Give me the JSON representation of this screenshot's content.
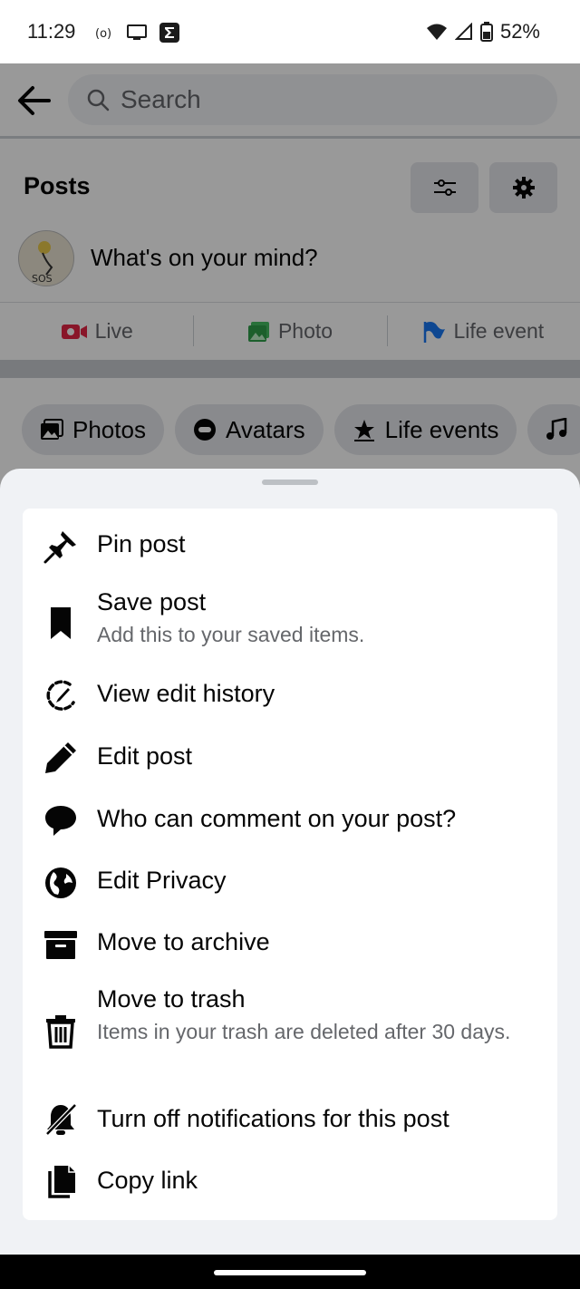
{
  "status_bar": {
    "time": "11:29",
    "battery": "52%",
    "left_icons": [
      "radio-icon",
      "monitor-icon",
      "sigma-icon"
    ],
    "right_icons": [
      "wifi-icon",
      "signal-icon",
      "battery-icon"
    ]
  },
  "header": {
    "search_placeholder": "Search"
  },
  "posts": {
    "title": "Posts",
    "composer_prompt": "What's on your mind?",
    "actions": [
      {
        "label": "Live",
        "color": "#e42645"
      },
      {
        "label": "Photo",
        "color": "#45bd62"
      },
      {
        "label": "Life event",
        "color": "#1877f2"
      }
    ],
    "chips": [
      {
        "label": "Photos"
      },
      {
        "label": "Avatars"
      },
      {
        "label": "Life events"
      },
      {
        "label": ""
      }
    ]
  },
  "sheet": {
    "items": [
      {
        "title": "Pin post",
        "icon": "pin-icon"
      },
      {
        "title": "Save post",
        "subtitle": "Add this to your saved items.",
        "icon": "bookmark-icon"
      },
      {
        "title": "View edit history",
        "icon": "edit-history-icon"
      },
      {
        "title": "Edit post",
        "icon": "pencil-icon"
      },
      {
        "title": "Who can comment on your post?",
        "icon": "comment-icon"
      },
      {
        "title": "Edit Privacy",
        "icon": "globe-icon"
      },
      {
        "title": "Move to archive",
        "icon": "archive-icon"
      },
      {
        "title": "Move to trash",
        "subtitle": "Items in your trash are deleted after 30 days.",
        "icon": "trash-icon"
      },
      {
        "title": "Turn off notifications for this post",
        "icon": "bell-off-icon"
      },
      {
        "title": "Copy link",
        "icon": "copy-icon"
      }
    ]
  }
}
